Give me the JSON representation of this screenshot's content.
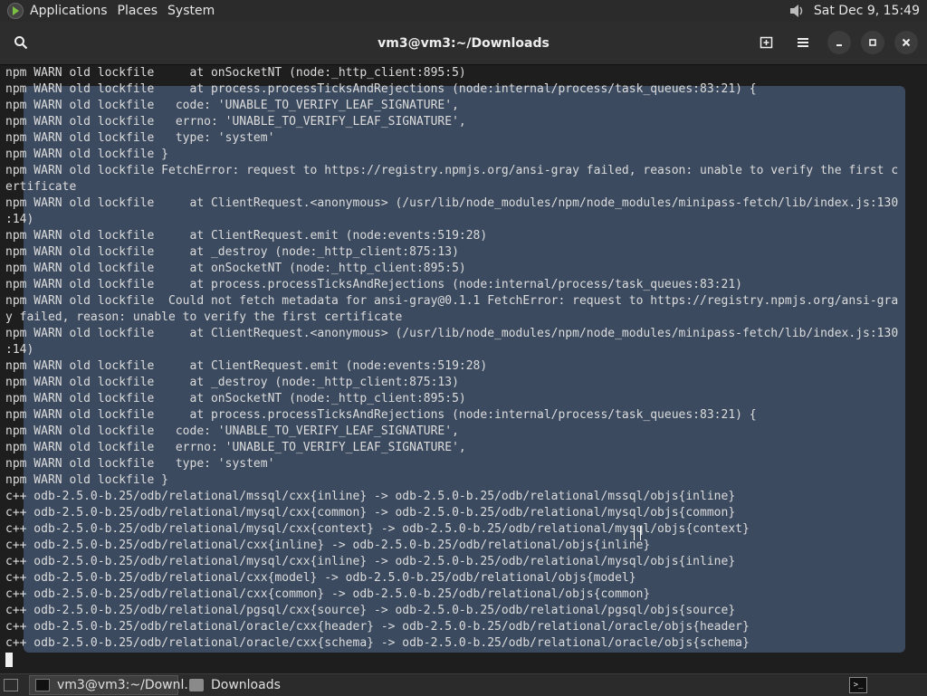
{
  "top_panel": {
    "menus": [
      "Applications",
      "Places",
      "System"
    ],
    "clock": "Sat Dec  9, 15:49",
    "volume_icon": "speaker-icon"
  },
  "window": {
    "title": "vm3@vm3:~/Downloads",
    "buttons": {
      "search": "search-icon",
      "new_tab": "new-tab-icon",
      "menu": "hamburger-menu-icon",
      "minimize": "minimize-icon",
      "maximize": "maximize-icon",
      "close": "close-icon"
    }
  },
  "terminal": {
    "lines": [
      "npm WARN old lockfile     at onSocketNT (node:_http_client:895:5)",
      "npm WARN old lockfile     at process.processTicksAndRejections (node:internal/process/task_queues:83:21) {",
      "npm WARN old lockfile   code: 'UNABLE_TO_VERIFY_LEAF_SIGNATURE',",
      "npm WARN old lockfile   errno: 'UNABLE_TO_VERIFY_LEAF_SIGNATURE',",
      "npm WARN old lockfile   type: 'system'",
      "npm WARN old lockfile }",
      "npm WARN old lockfile FetchError: request to https://registry.npmjs.org/ansi-gray failed, reason: unable to verify the first c",
      "ertificate",
      "npm WARN old lockfile     at ClientRequest.<anonymous> (/usr/lib/node_modules/npm/node_modules/minipass-fetch/lib/index.js:130",
      ":14)",
      "npm WARN old lockfile     at ClientRequest.emit (node:events:519:28)",
      "npm WARN old lockfile     at _destroy (node:_http_client:875:13)",
      "npm WARN old lockfile     at onSocketNT (node:_http_client:895:5)",
      "npm WARN old lockfile     at process.processTicksAndRejections (node:internal/process/task_queues:83:21)",
      "npm WARN old lockfile  Could not fetch metadata for ansi-gray@0.1.1 FetchError: request to https://registry.npmjs.org/ansi-gra",
      "y failed, reason: unable to verify the first certificate",
      "npm WARN old lockfile     at ClientRequest.<anonymous> (/usr/lib/node_modules/npm/node_modules/minipass-fetch/lib/index.js:130",
      ":14)",
      "npm WARN old lockfile     at ClientRequest.emit (node:events:519:28)",
      "npm WARN old lockfile     at _destroy (node:_http_client:875:13)",
      "npm WARN old lockfile     at onSocketNT (node:_http_client:895:5)",
      "npm WARN old lockfile     at process.processTicksAndRejections (node:internal/process/task_queues:83:21) {",
      "npm WARN old lockfile   code: 'UNABLE_TO_VERIFY_LEAF_SIGNATURE',",
      "npm WARN old lockfile   errno: 'UNABLE_TO_VERIFY_LEAF_SIGNATURE',",
      "npm WARN old lockfile   type: 'system'",
      "npm WARN old lockfile }",
      "c++ odb-2.5.0-b.25/odb/relational/mssql/cxx{inline} -> odb-2.5.0-b.25/odb/relational/mssql/objs{inline}",
      "c++ odb-2.5.0-b.25/odb/relational/mysql/cxx{common} -> odb-2.5.0-b.25/odb/relational/mysql/objs{common}",
      "c++ odb-2.5.0-b.25/odb/relational/mysql/cxx{context} -> odb-2.5.0-b.25/odb/relational/mysql/objs{context}",
      "c++ odb-2.5.0-b.25/odb/relational/cxx{inline} -> odb-2.5.0-b.25/odb/relational/objs{inline}",
      "c++ odb-2.5.0-b.25/odb/relational/mysql/cxx{inline} -> odb-2.5.0-b.25/odb/relational/mysql/objs{inline}",
      "c++ odb-2.5.0-b.25/odb/relational/cxx{model} -> odb-2.5.0-b.25/odb/relational/objs{model}",
      "c++ odb-2.5.0-b.25/odb/relational/cxx{common} -> odb-2.5.0-b.25/odb/relational/objs{common}",
      "c++ odb-2.5.0-b.25/odb/relational/pgsql/cxx{source} -> odb-2.5.0-b.25/odb/relational/pgsql/objs{source}",
      "c++ odb-2.5.0-b.25/odb/relational/oracle/cxx{header} -> odb-2.5.0-b.25/odb/relational/oracle/objs{header}",
      "c++ odb-2.5.0-b.25/odb/relational/oracle/cxx{schema} -> odb-2.5.0-b.25/odb/relational/oracle/objs{schema}"
    ]
  },
  "taskbar": {
    "tasks": [
      {
        "label": "vm3@vm3:~/Downl...",
        "icon": "terminal-icon",
        "active": true
      },
      {
        "label": "Downloads",
        "icon": "folder-icon",
        "active": false
      }
    ],
    "tray_icon": "terminal-tray-icon"
  },
  "colors": {
    "selection": "#3b4a5f",
    "terminal_bg": "#1e1e1e",
    "text": "#dcdcdc"
  }
}
